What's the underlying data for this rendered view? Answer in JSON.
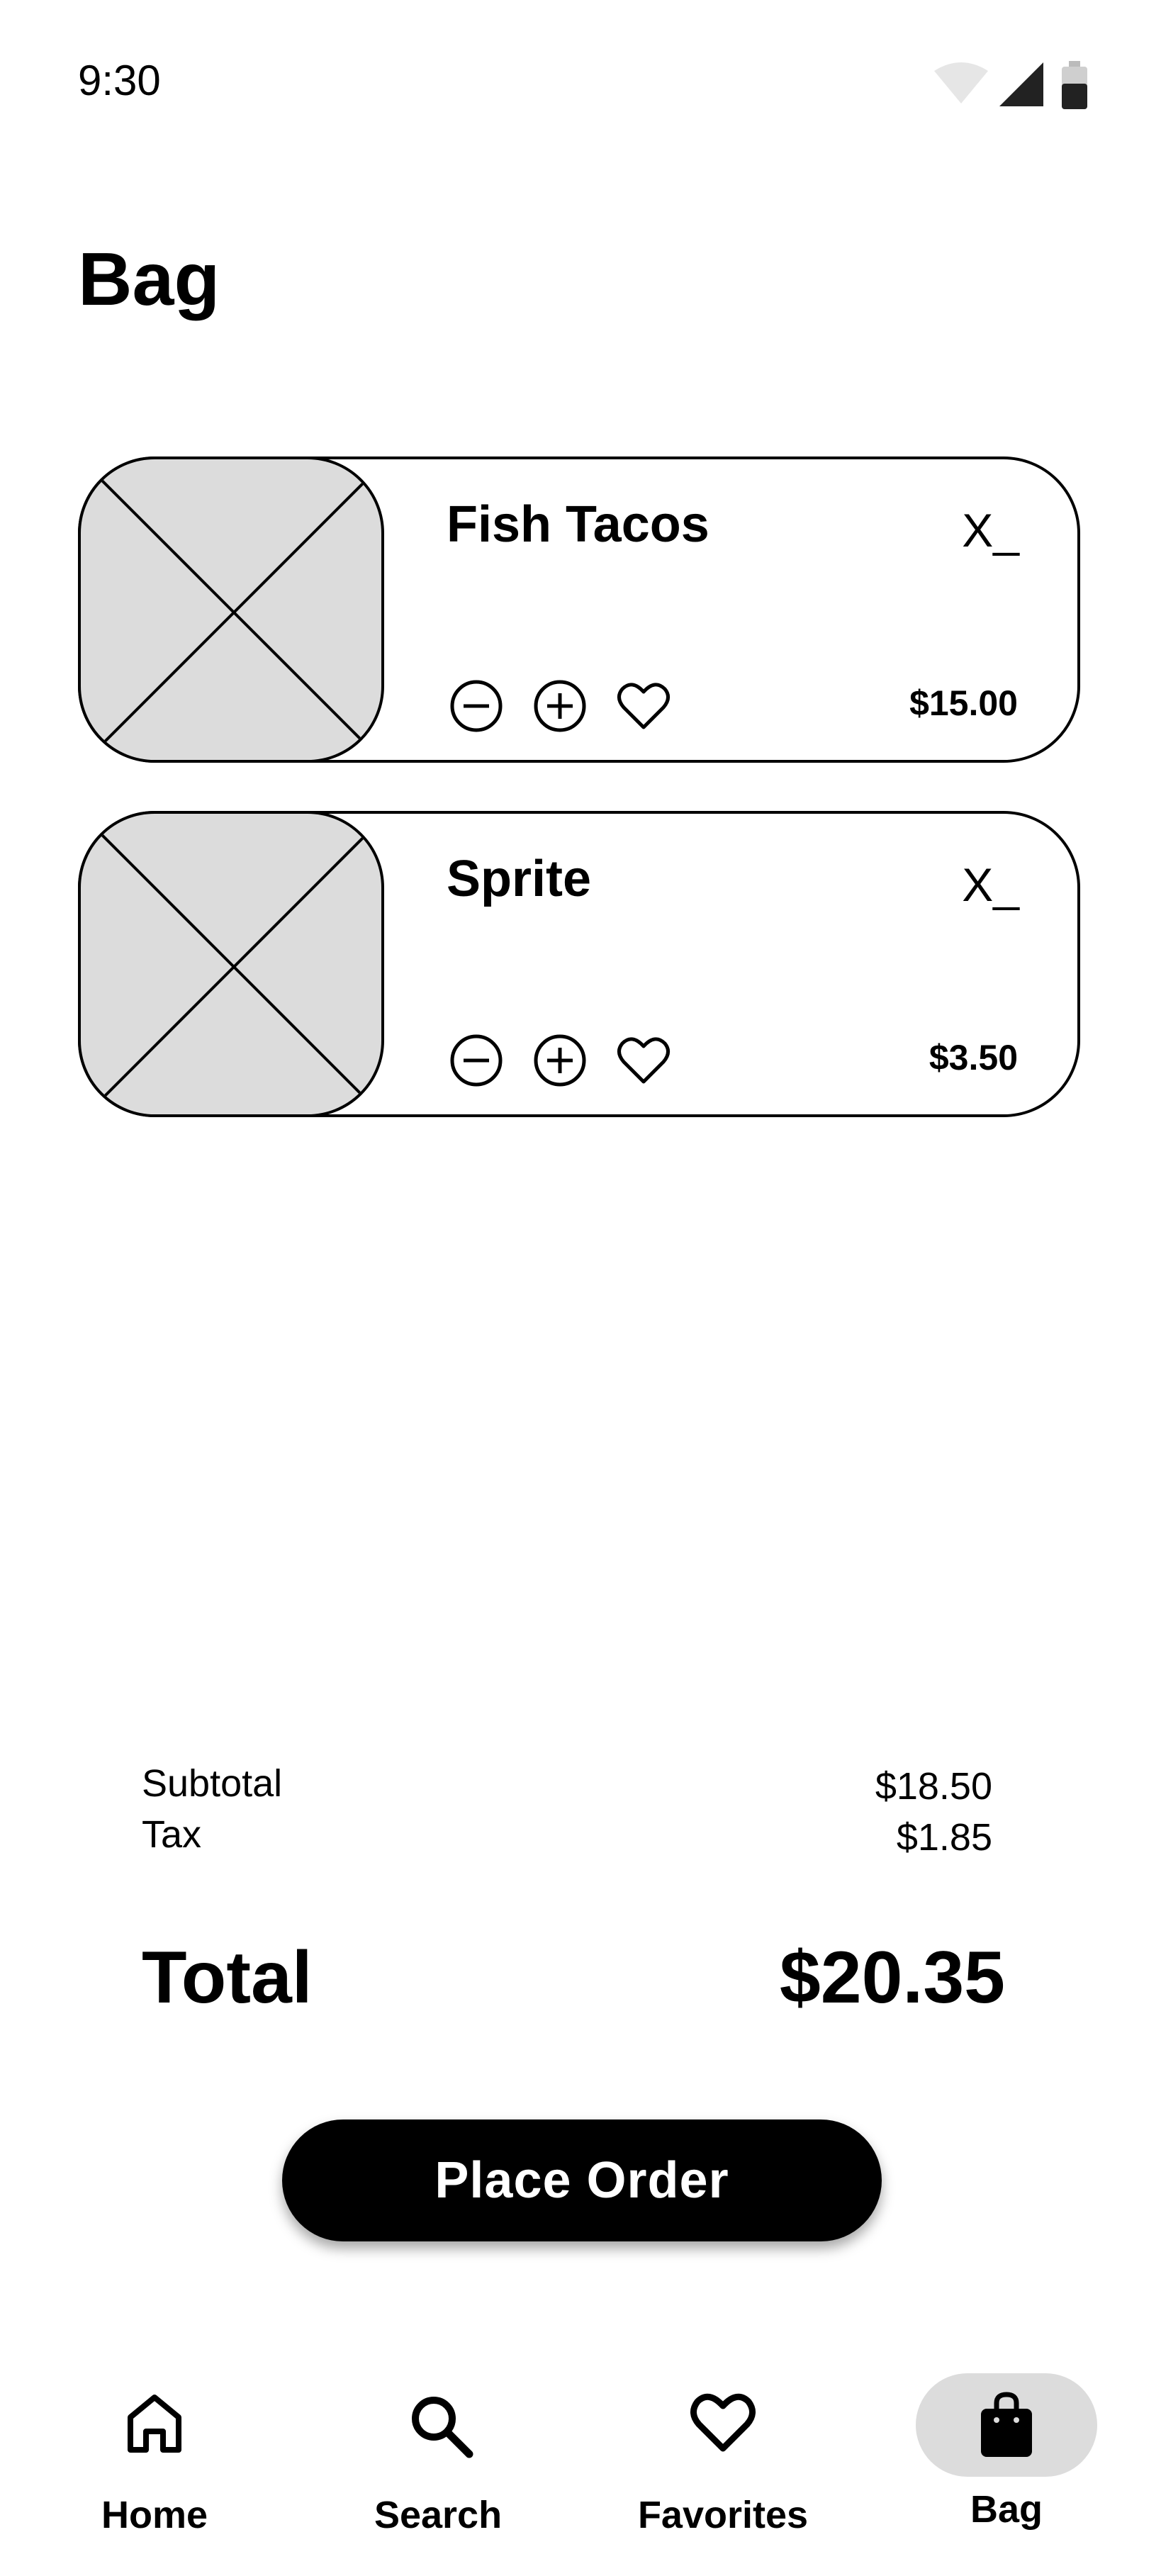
{
  "status_bar": {
    "time": "9:30",
    "icons": [
      "wifi-icon",
      "signal-icon",
      "battery-icon"
    ]
  },
  "page": {
    "title": "Bag"
  },
  "cart": {
    "items": [
      {
        "name": "Fish Tacos",
        "remove_label": "X_",
        "price": "$15.00",
        "actions": [
          "minus-circle-icon",
          "plus-circle-icon",
          "heart-icon"
        ]
      },
      {
        "name": "Sprite",
        "remove_label": "X_",
        "price": "$3.50",
        "actions": [
          "minus-circle-icon",
          "plus-circle-icon",
          "heart-icon"
        ]
      }
    ]
  },
  "summary": {
    "subtotal_label": "Subtotal",
    "subtotal_value": "$18.50",
    "tax_label": "Tax",
    "tax_value": "$1.85",
    "total_label": "Total",
    "total_value": "$20.35"
  },
  "actions": {
    "place_order_label": "Place Order"
  },
  "nav": {
    "active": "Bag",
    "items": [
      {
        "label": "Home",
        "icon": "home-icon"
      },
      {
        "label": "Search",
        "icon": "search-icon"
      },
      {
        "label": "Favorites",
        "icon": "heart-icon"
      },
      {
        "label": "Bag",
        "icon": "shopping-bag-icon"
      }
    ]
  },
  "colors": {
    "primary": "#000000",
    "background": "#ffffff",
    "placeholder": "#dcdcdc",
    "active_pill": "#dcdcdc"
  }
}
